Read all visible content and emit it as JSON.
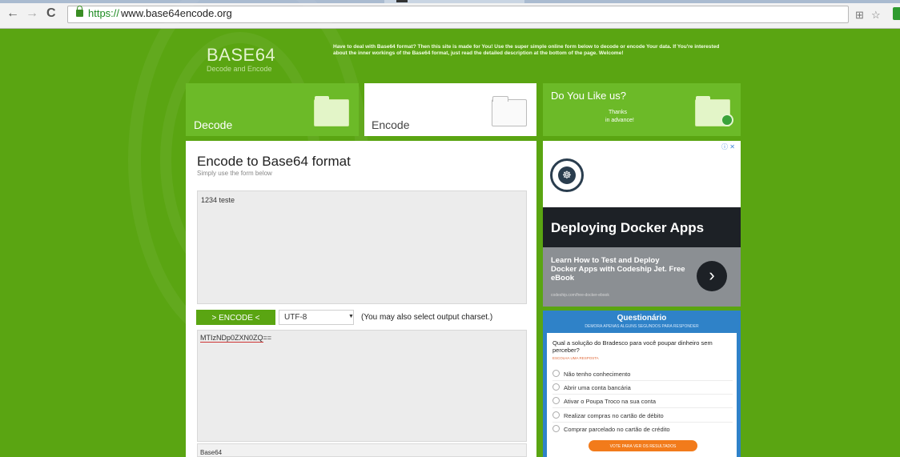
{
  "browser": {
    "url_https": "https://",
    "url_rest": "www.base64encode.org"
  },
  "header": {
    "logo": "BASE64",
    "logo_sub": "Decode and Encode",
    "intro": "Have to deal with Base64 format? Then this site is made for You! Use the super simple online form below to decode or encode Your data. If You're interested about the inner workings of the Base64 format, just read the detailed description at the bottom of the page. Welcome!"
  },
  "tiles": {
    "decode": "Decode",
    "encode": "Encode",
    "like_title": "Do You Like us?",
    "like_sub1": "Thanks",
    "like_sub2": "in advance!"
  },
  "main": {
    "title": "Encode to Base64 format",
    "subtitle": "Simply use the form below",
    "input_value": "1234 teste",
    "encode_button": "> ENCODE <",
    "charset": "UTF-8",
    "charset_hint": "(You may also select output charset.)",
    "result_prefix": "MTIzNDp0ZXN0ZQ",
    "result_suffix": "==",
    "bottom_label": "Base64"
  },
  "ad": {
    "close": "ⓘ ✕",
    "title": "Deploying Docker Apps",
    "desc": "Learn How to Test and Deploy Docker Apps with Codeship Jet. Free eBook",
    "domain": "codeship.com/free-docker-ebook"
  },
  "quiz": {
    "title": "Questionário",
    "subtitle": "DEMORA APENAS ALGUNS SEGUNDOS PARA RESPONDER",
    "question": "Qual a solução do Bradesco para você poupar dinheiro sem perceber?",
    "note": "ESCOLHA UMA RESPOSTA",
    "options": [
      "Não tenho conhecimento",
      "Abrir uma conta bancária",
      "Ativar o Poupa Troco na sua conta",
      "Realizar compras no cartão de débito",
      "Comprar parcelado no cartão de crédito"
    ],
    "button": "VOTE PARA VER OS RESULTADOS"
  },
  "colors": {
    "background": "#5aa512",
    "tile_green": "#6cba28",
    "quiz_blue": "#2f82c8",
    "quiz_button": "#f27b1b"
  }
}
